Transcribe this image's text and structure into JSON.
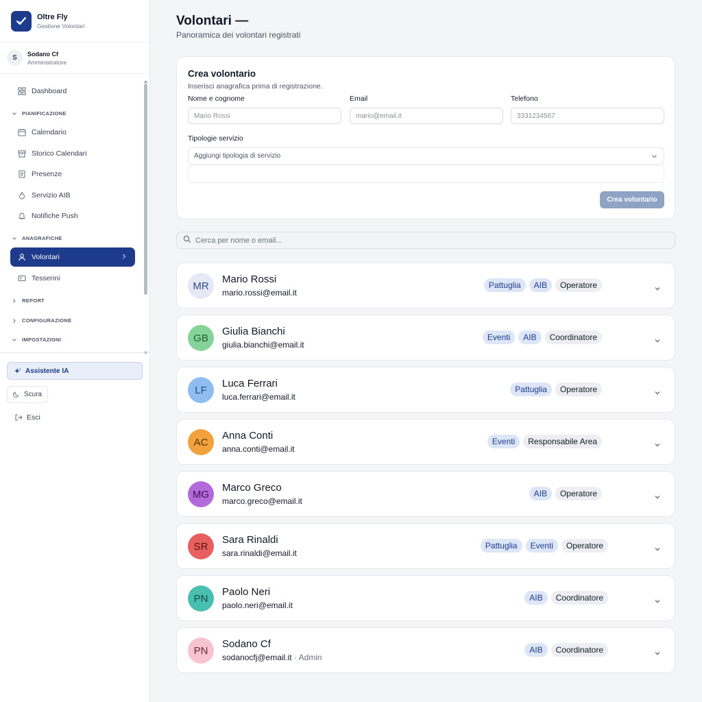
{
  "app": {
    "name": "Oltre Fly",
    "subtitle": "Gestione Volontari"
  },
  "user": {
    "initial": "S",
    "name": "Sodano Cf",
    "role": "Amministratore"
  },
  "sidebar": {
    "dashboard": "Dashboard",
    "sections": {
      "pianificazione": "PIANIFICAZIONE",
      "anagrafiche": "ANAGRAFICHE",
      "report": "REPORT",
      "configurazione": "CONFIGURAZIONE",
      "impostazioni": "IMPOSTAZIONI"
    },
    "items": {
      "calendario": "Calendario",
      "storico": "Storico Calendari",
      "presenze": "Presenze",
      "servizio_aib": "Servizio AIB",
      "notifiche": "Notifiche Push",
      "volontari": "Volontari",
      "tesserini": "Tesserini"
    },
    "assistant": "Assistente IA",
    "theme": "Scura",
    "logout": "Esci"
  },
  "header": {
    "title": "Volontari —",
    "subtitle": "Panoramica dei volontari registrati"
  },
  "form": {
    "title": "Crea volontario",
    "subtitle": "Inserisci anagrafica prima di registrazione.",
    "name_label": "Nome e cognome",
    "name_placeholder": "Mario Rossi",
    "email_label": "Email",
    "email_placeholder": "mario@email.it",
    "phone_label": "Telefono",
    "phone_placeholder": "3331234567",
    "types_label": "Tipologie servizio",
    "types_placeholder": "Aggiungi tipologia di servizio",
    "submit": "Crea volontario"
  },
  "search": {
    "placeholder": "Cerca per nome o email..."
  },
  "volunteers": [
    {
      "initials": "MR",
      "name": "Mario Rossi",
      "email": "mario.rossi@email.it",
      "services": [
        "Pattuglia",
        "AIB"
      ],
      "role": "Operatore",
      "avatar_bg": "#e4e9f5",
      "avatar_fg": "#2c4a8a"
    },
    {
      "initials": "GB",
      "name": "Giulia Bianchi",
      "email": "giulia.bianchi@email.it",
      "services": [
        "Eventi",
        "AIB"
      ],
      "role": "Coordinatore",
      "avatar_bg": "#86d39a",
      "avatar_fg": "#1f5f34"
    },
    {
      "initials": "LF",
      "name": "Luca Ferrari",
      "email": "luca.ferrari@email.it",
      "services": [
        "Pattuglia"
      ],
      "role": "Operatore",
      "avatar_bg": "#8fbdf0",
      "avatar_fg": "#22518a"
    },
    {
      "initials": "AC",
      "name": "Anna Conti",
      "email": "anna.conti@email.it",
      "services": [
        "Eventi"
      ],
      "role": "Responsabile Area",
      "avatar_bg": "#f2a23c",
      "avatar_fg": "#5a3205"
    },
    {
      "initials": "MG",
      "name": "Marco Greco",
      "email": "marco.greco@email.it",
      "services": [
        "AIB"
      ],
      "role": "Operatore",
      "avatar_bg": "#b46ad8",
      "avatar_fg": "#3e0f57"
    },
    {
      "initials": "SR",
      "name": "Sara Rinaldi",
      "email": "sara.rinaldi@email.it",
      "services": [
        "Pattuglia",
        "Eventi"
      ],
      "role": "Operatore",
      "avatar_bg": "#e85f5f",
      "avatar_fg": "#5a1010"
    },
    {
      "initials": "PN",
      "name": "Paolo Neri",
      "email": "paolo.neri@email.it",
      "services": [
        "AIB"
      ],
      "role": "Coordinatore",
      "avatar_bg": "#48bfb0",
      "avatar_fg": "#0f4a44"
    },
    {
      "initials": "PN",
      "name": "Sodano Cf",
      "email": "sodanocfj@email.it",
      "extra": " · Admin",
      "services": [
        "AIB"
      ],
      "role": "Coordinatore",
      "avatar_bg": "#f6c3cf",
      "avatar_fg": "#6b2a3a"
    }
  ],
  "colors": {
    "primary": "#1e3a8a",
    "button_disabled": "#8fa3c4",
    "service_badge": "#dce6f6",
    "role_badge": "#eceef1"
  }
}
